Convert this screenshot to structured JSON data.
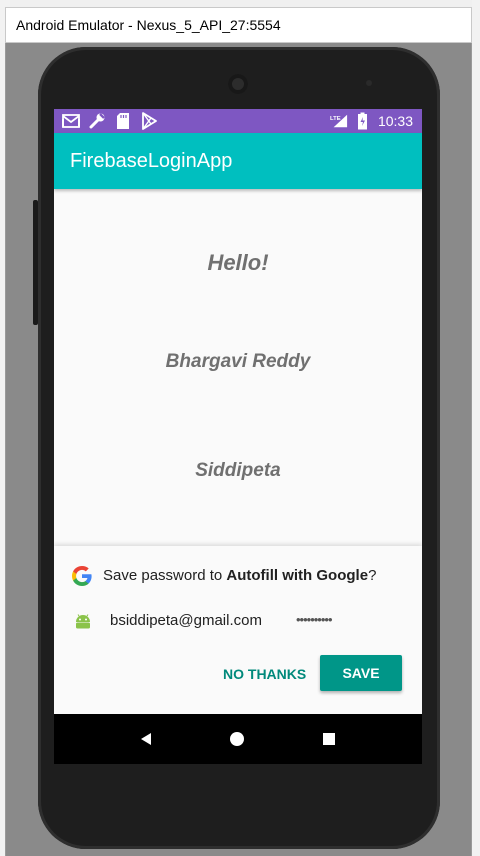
{
  "window": {
    "title": "Android Emulator - Nexus_5_API_27:5554"
  },
  "status_bar": {
    "time": "10:33",
    "network": "LTE",
    "bg_color": "#7e57c2",
    "left_icons": [
      "gmail-icon",
      "wrench-icon",
      "sdcard-icon",
      "play-store-icon"
    ],
    "right_icons": [
      "signal-icon",
      "battery-icon"
    ]
  },
  "app_bar": {
    "title": "FirebaseLoginApp",
    "color": "#00bfbf"
  },
  "content": {
    "greeting": "Hello!",
    "name": "Bhargavi Reddy",
    "place": "Siddipeta"
  },
  "autofill": {
    "title_prefix": "Save password to ",
    "title_bold": "Autofill with Google",
    "title_suffix": "?",
    "email": "bsiddipeta@gmail.com",
    "password_masked": "••••••••••",
    "no_thanks_label": "NO THANKS",
    "save_label": "SAVE",
    "accent_color": "#009688"
  },
  "nav_bar": {
    "buttons": [
      "back-icon",
      "home-icon",
      "recents-icon"
    ]
  }
}
